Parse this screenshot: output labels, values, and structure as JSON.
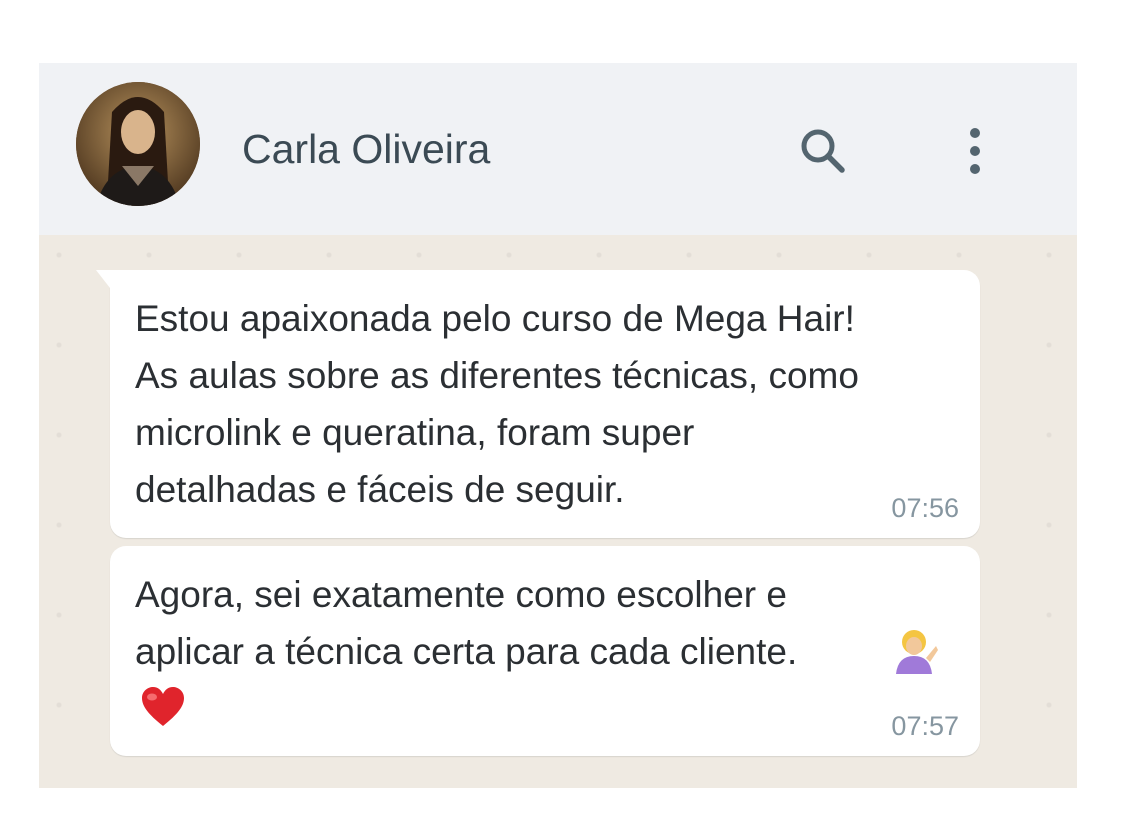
{
  "contact": {
    "name": "Carla Oliveira",
    "avatar": "profile-photo"
  },
  "header": {
    "icons": [
      "search-icon",
      "more-vertical-icon"
    ]
  },
  "messages": [
    {
      "text": "Estou apaixonada pelo curso de Mega Hair!\nAs aulas sobre as diferentes técnicas, como\nmicrolink e queratina, foram super\ndetalhadas e fáceis de seguir.",
      "time": "07:56"
    },
    {
      "text": "Agora, sei exatamente como escolher e\naplicar a técnica certa para cada cliente.",
      "emojis": [
        "woman-tipping-hand-emoji",
        "red-heart-emoji"
      ],
      "time": "07:57"
    }
  ],
  "colors": {
    "header_bg": "#f0f2f5",
    "chat_bg": "#efeae2",
    "bubble_bg": "#ffffff",
    "time_text": "#8696a0"
  }
}
